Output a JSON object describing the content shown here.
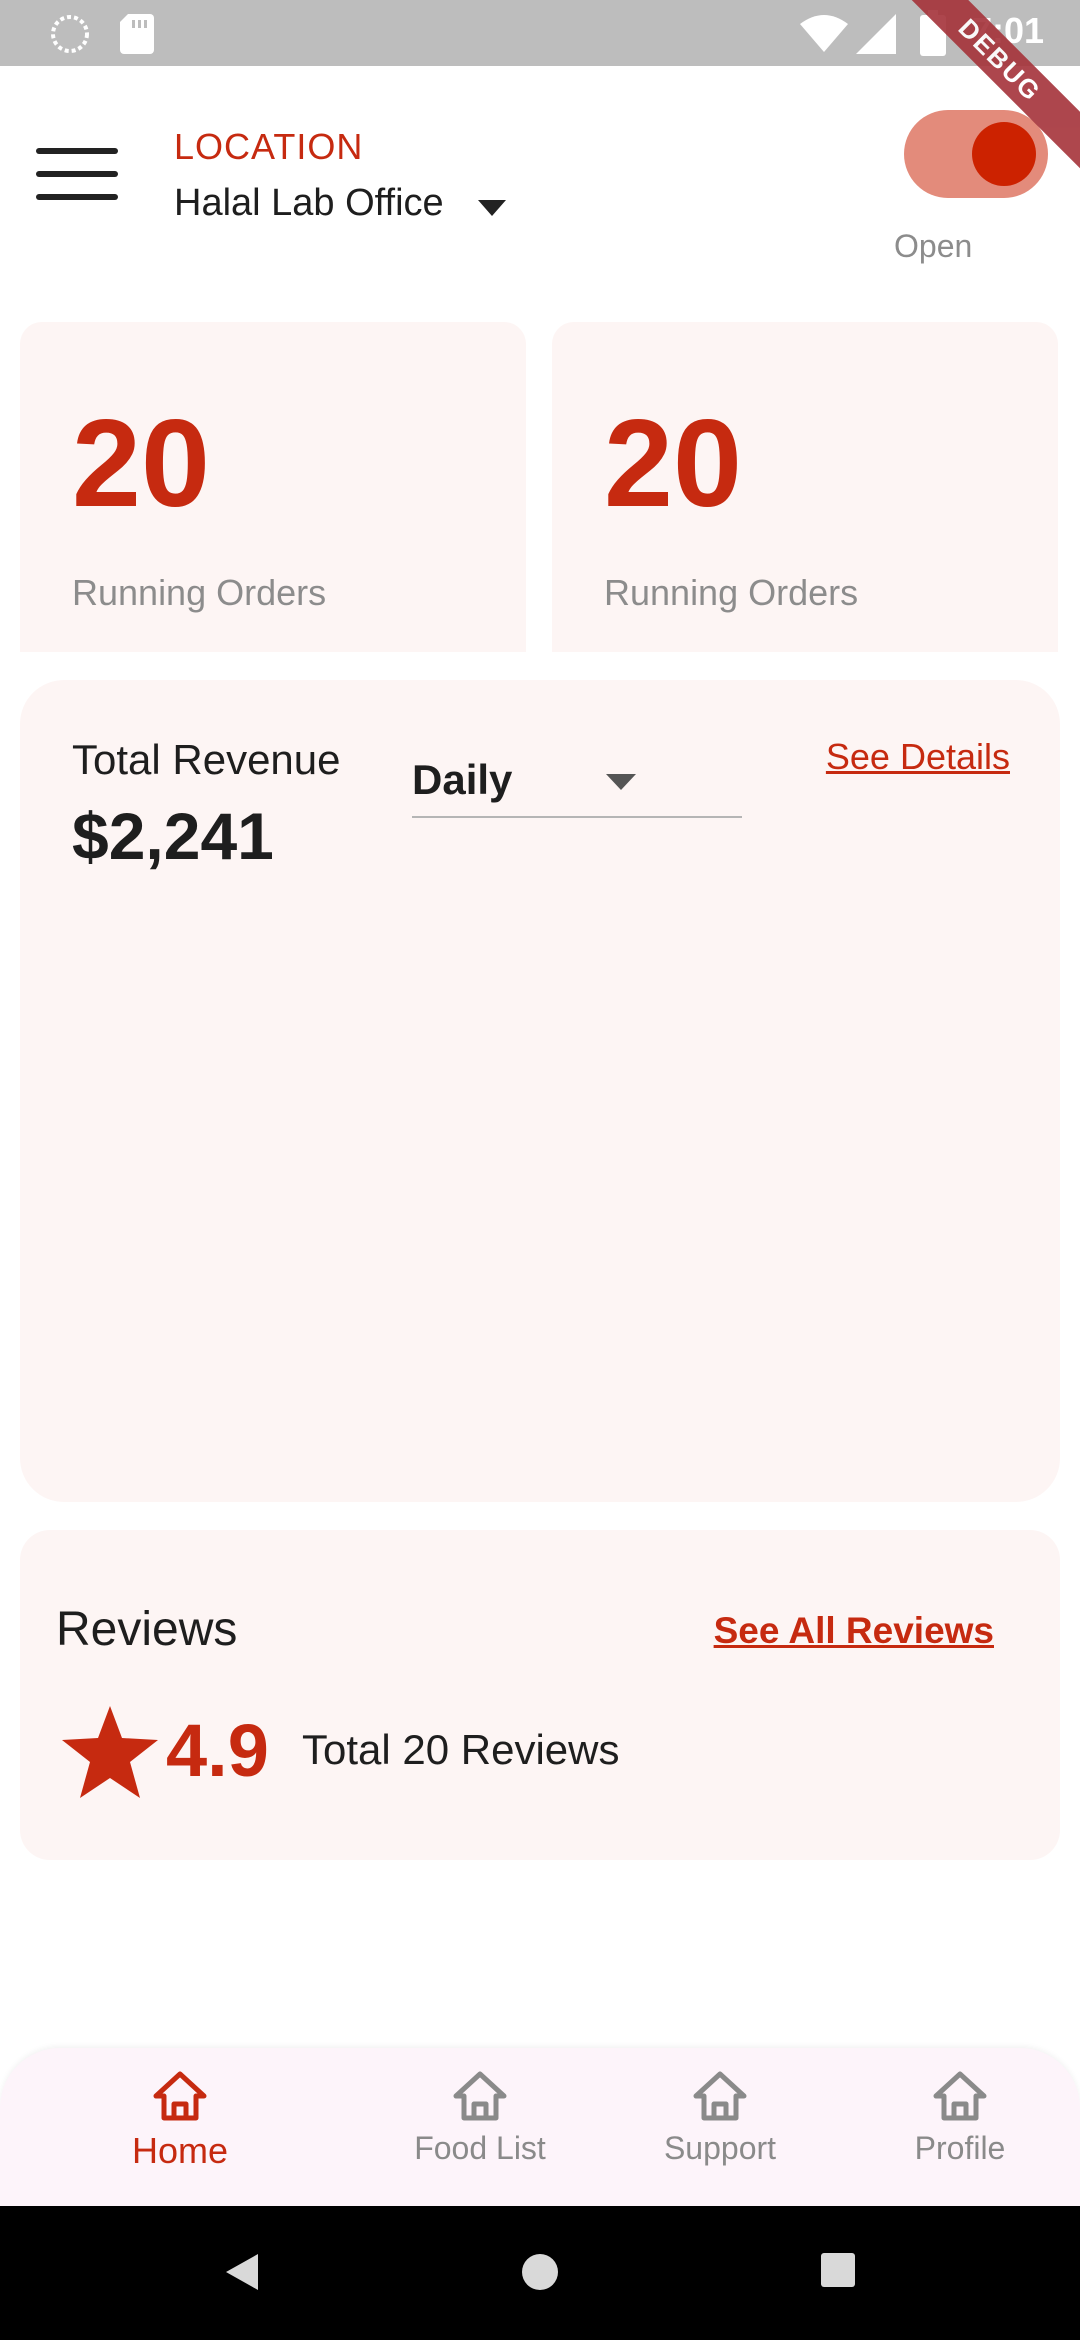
{
  "status_bar": {
    "time": "7:01",
    "debug_banner": "DEBUG"
  },
  "header": {
    "location_label": "LOCATION",
    "location_value": "Halal Lab Office",
    "toggle_label": "Open",
    "toggle_on": true
  },
  "stats": [
    {
      "value": "20",
      "label": "Running Orders"
    },
    {
      "value": "20",
      "label": "Running Orders"
    }
  ],
  "revenue": {
    "title": "Total Revenue",
    "amount": "$2,241",
    "period": "Daily",
    "details_link": "See Details"
  },
  "reviews": {
    "title": "Reviews",
    "see_all_link": "See All Reviews",
    "rating": "4.9",
    "total_text": "Total 20 Reviews"
  },
  "bottom_nav": {
    "items": [
      {
        "label": "Home",
        "icon": "home-icon",
        "active": true
      },
      {
        "label": "Food List",
        "icon": "home-icon",
        "active": false
      },
      {
        "label": "Support",
        "icon": "home-icon",
        "active": false
      },
      {
        "label": "Profile",
        "icon": "home-icon",
        "active": false
      }
    ]
  },
  "colors": {
    "accent": "#c62a10",
    "card_bg": "#fdf5f4",
    "toggle_track": "#e38b7b",
    "muted_text": "#8c8c8c"
  }
}
